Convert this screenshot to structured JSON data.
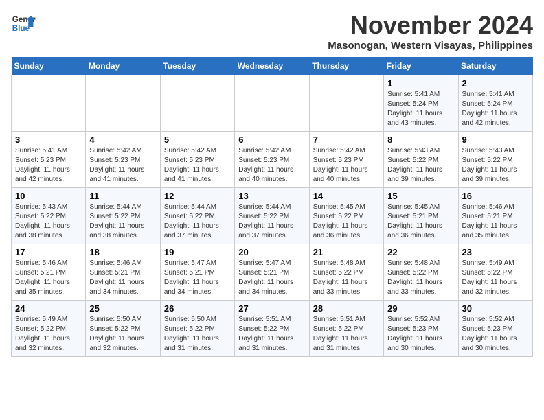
{
  "logo": {
    "line1": "General",
    "line2": "Blue"
  },
  "title": "November 2024",
  "subtitle": "Masonogan, Western Visayas, Philippines",
  "weekdays": [
    "Sunday",
    "Monday",
    "Tuesday",
    "Wednesday",
    "Thursday",
    "Friday",
    "Saturday"
  ],
  "weeks": [
    [
      {
        "day": "",
        "detail": ""
      },
      {
        "day": "",
        "detail": ""
      },
      {
        "day": "",
        "detail": ""
      },
      {
        "day": "",
        "detail": ""
      },
      {
        "day": "",
        "detail": ""
      },
      {
        "day": "1",
        "detail": "Sunrise: 5:41 AM\nSunset: 5:24 PM\nDaylight: 11 hours and 43 minutes."
      },
      {
        "day": "2",
        "detail": "Sunrise: 5:41 AM\nSunset: 5:24 PM\nDaylight: 11 hours and 42 minutes."
      }
    ],
    [
      {
        "day": "3",
        "detail": "Sunrise: 5:41 AM\nSunset: 5:23 PM\nDaylight: 11 hours and 42 minutes."
      },
      {
        "day": "4",
        "detail": "Sunrise: 5:42 AM\nSunset: 5:23 PM\nDaylight: 11 hours and 41 minutes."
      },
      {
        "day": "5",
        "detail": "Sunrise: 5:42 AM\nSunset: 5:23 PM\nDaylight: 11 hours and 41 minutes."
      },
      {
        "day": "6",
        "detail": "Sunrise: 5:42 AM\nSunset: 5:23 PM\nDaylight: 11 hours and 40 minutes."
      },
      {
        "day": "7",
        "detail": "Sunrise: 5:42 AM\nSunset: 5:23 PM\nDaylight: 11 hours and 40 minutes."
      },
      {
        "day": "8",
        "detail": "Sunrise: 5:43 AM\nSunset: 5:22 PM\nDaylight: 11 hours and 39 minutes."
      },
      {
        "day": "9",
        "detail": "Sunrise: 5:43 AM\nSunset: 5:22 PM\nDaylight: 11 hours and 39 minutes."
      }
    ],
    [
      {
        "day": "10",
        "detail": "Sunrise: 5:43 AM\nSunset: 5:22 PM\nDaylight: 11 hours and 38 minutes."
      },
      {
        "day": "11",
        "detail": "Sunrise: 5:44 AM\nSunset: 5:22 PM\nDaylight: 11 hours and 38 minutes."
      },
      {
        "day": "12",
        "detail": "Sunrise: 5:44 AM\nSunset: 5:22 PM\nDaylight: 11 hours and 37 minutes."
      },
      {
        "day": "13",
        "detail": "Sunrise: 5:44 AM\nSunset: 5:22 PM\nDaylight: 11 hours and 37 minutes."
      },
      {
        "day": "14",
        "detail": "Sunrise: 5:45 AM\nSunset: 5:22 PM\nDaylight: 11 hours and 36 minutes."
      },
      {
        "day": "15",
        "detail": "Sunrise: 5:45 AM\nSunset: 5:21 PM\nDaylight: 11 hours and 36 minutes."
      },
      {
        "day": "16",
        "detail": "Sunrise: 5:46 AM\nSunset: 5:21 PM\nDaylight: 11 hours and 35 minutes."
      }
    ],
    [
      {
        "day": "17",
        "detail": "Sunrise: 5:46 AM\nSunset: 5:21 PM\nDaylight: 11 hours and 35 minutes."
      },
      {
        "day": "18",
        "detail": "Sunrise: 5:46 AM\nSunset: 5:21 PM\nDaylight: 11 hours and 34 minutes."
      },
      {
        "day": "19",
        "detail": "Sunrise: 5:47 AM\nSunset: 5:21 PM\nDaylight: 11 hours and 34 minutes."
      },
      {
        "day": "20",
        "detail": "Sunrise: 5:47 AM\nSunset: 5:21 PM\nDaylight: 11 hours and 34 minutes."
      },
      {
        "day": "21",
        "detail": "Sunrise: 5:48 AM\nSunset: 5:22 PM\nDaylight: 11 hours and 33 minutes."
      },
      {
        "day": "22",
        "detail": "Sunrise: 5:48 AM\nSunset: 5:22 PM\nDaylight: 11 hours and 33 minutes."
      },
      {
        "day": "23",
        "detail": "Sunrise: 5:49 AM\nSunset: 5:22 PM\nDaylight: 11 hours and 32 minutes."
      }
    ],
    [
      {
        "day": "24",
        "detail": "Sunrise: 5:49 AM\nSunset: 5:22 PM\nDaylight: 11 hours and 32 minutes."
      },
      {
        "day": "25",
        "detail": "Sunrise: 5:50 AM\nSunset: 5:22 PM\nDaylight: 11 hours and 32 minutes."
      },
      {
        "day": "26",
        "detail": "Sunrise: 5:50 AM\nSunset: 5:22 PM\nDaylight: 11 hours and 31 minutes."
      },
      {
        "day": "27",
        "detail": "Sunrise: 5:51 AM\nSunset: 5:22 PM\nDaylight: 11 hours and 31 minutes."
      },
      {
        "day": "28",
        "detail": "Sunrise: 5:51 AM\nSunset: 5:22 PM\nDaylight: 11 hours and 31 minutes."
      },
      {
        "day": "29",
        "detail": "Sunrise: 5:52 AM\nSunset: 5:23 PM\nDaylight: 11 hours and 30 minutes."
      },
      {
        "day": "30",
        "detail": "Sunrise: 5:52 AM\nSunset: 5:23 PM\nDaylight: 11 hours and 30 minutes."
      }
    ]
  ]
}
